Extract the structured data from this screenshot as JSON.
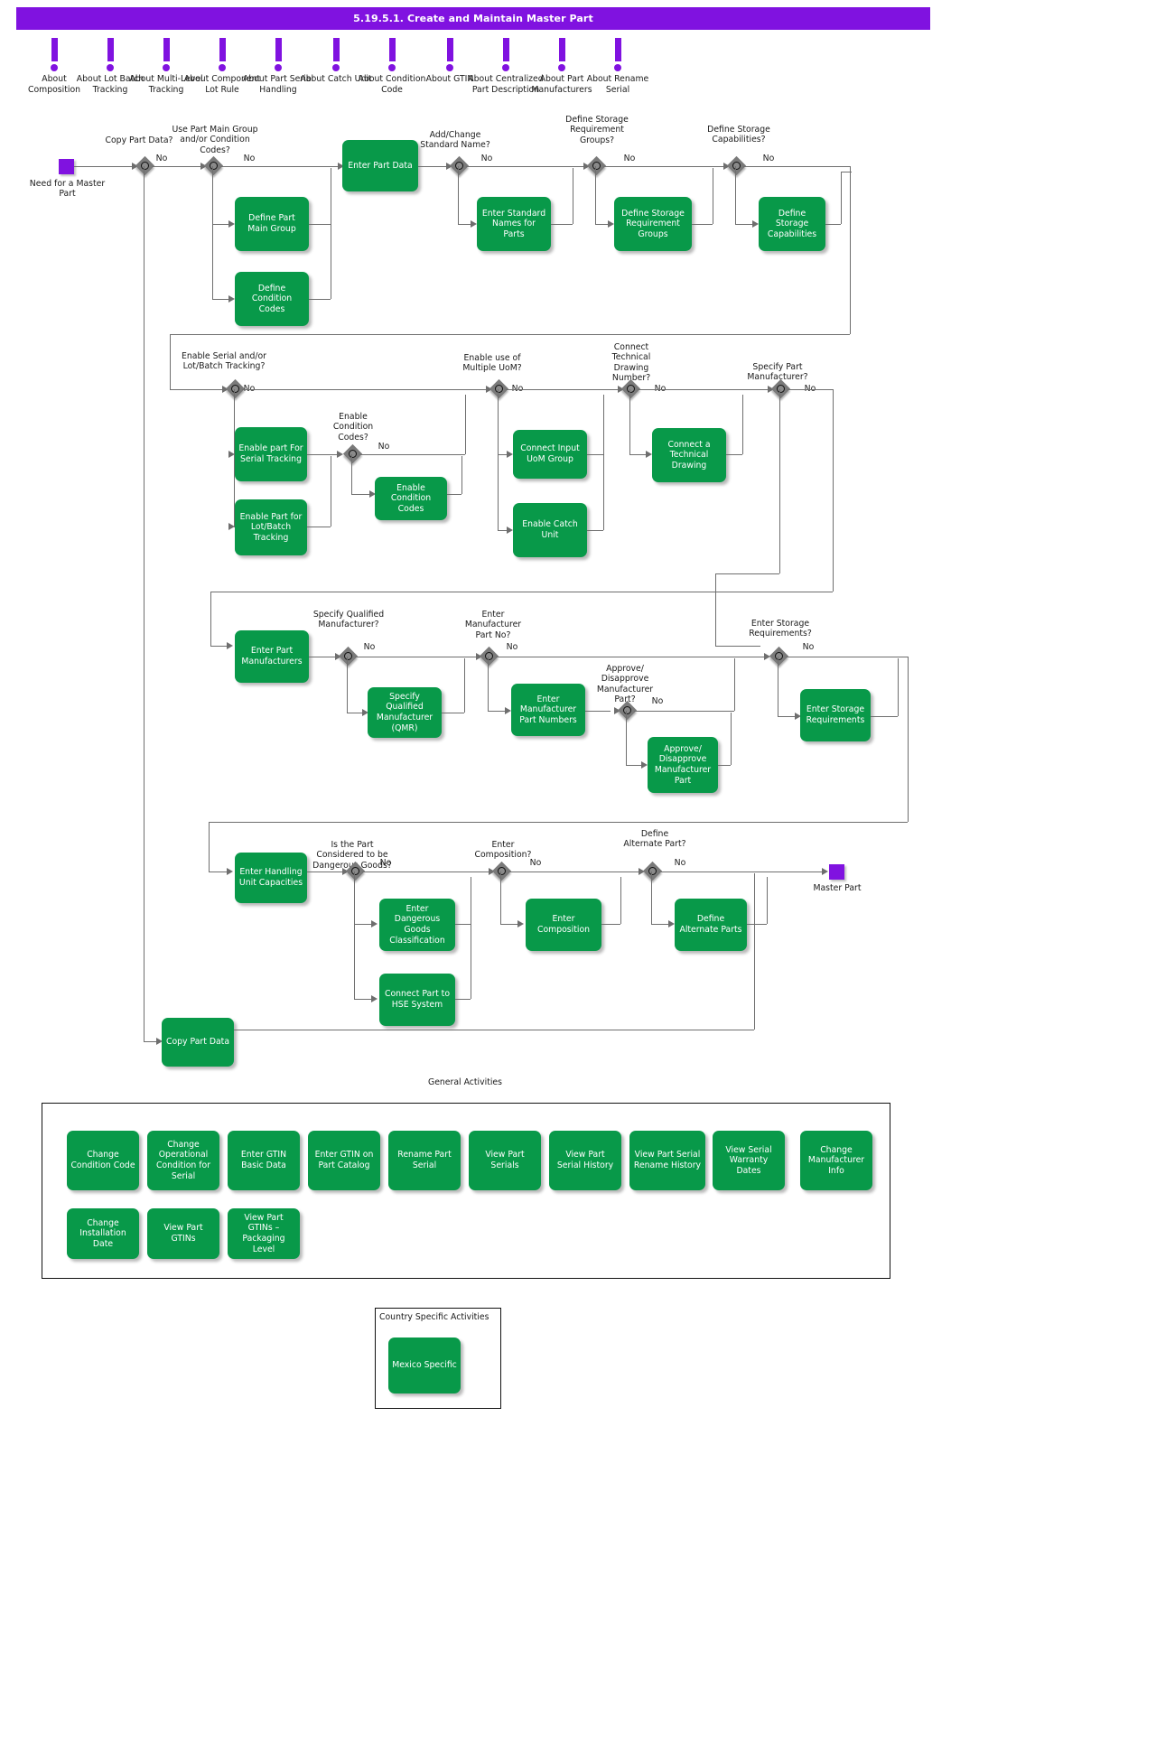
{
  "title": "5.19.5.1. Create and Maintain Master Part",
  "about_links": [
    {
      "label": "About Composition"
    },
    {
      "label": "About Lot Batch Tracking"
    },
    {
      "label": "About Multi-Level Tracking"
    },
    {
      "label": "About Component Lot Rule"
    },
    {
      "label": "About Part Serial Handling"
    },
    {
      "label": "About Catch Unit"
    },
    {
      "label": "About Condition Code"
    },
    {
      "label": "About GTIN"
    },
    {
      "label": "About Centralized Part Description"
    },
    {
      "label": "About Part Manufacturers"
    },
    {
      "label": "About Rename Serial"
    }
  ],
  "events": {
    "start": "Need for a Master Part",
    "end": "Master Part"
  },
  "gateways": [
    {
      "id": "g_copy",
      "question": "Copy Part Data?",
      "no": "No"
    },
    {
      "id": "g_maingroup",
      "question": "Use Part Main Group and/or Condition Codes?",
      "no": "No"
    },
    {
      "id": "g_stdname",
      "question": "Add/Change Standard Name?",
      "no": "No"
    },
    {
      "id": "g_storagereq",
      "question": "Define Storage Requirement Groups?",
      "no": "No"
    },
    {
      "id": "g_storagecap",
      "question": "Define Storage Capabilities?",
      "no": "No"
    },
    {
      "id": "g_serial",
      "question": "Enable Serial and/or Lot/Batch Tracking?",
      "no": "No"
    },
    {
      "id": "g_condcodes",
      "question": "Enable Condition Codes?",
      "no": "No"
    },
    {
      "id": "g_uom",
      "question": "Enable use of Multiple UoM?",
      "no": "No"
    },
    {
      "id": "g_drawing",
      "question": "Connect Technical Drawing Number?",
      "no": "No"
    },
    {
      "id": "g_specmanu",
      "question": "Specify Part Manufacturer?",
      "no": "No"
    },
    {
      "id": "g_qualmanu",
      "question": "Specify Qualified Manufacturer?",
      "no": "No"
    },
    {
      "id": "g_manupartno",
      "question": "Enter Manufacturer Part No?",
      "no": "No"
    },
    {
      "id": "g_approve",
      "question": "Approve/ Disapprove Manufacturer Part?",
      "no": "No"
    },
    {
      "id": "g_storagereqs",
      "question": "Enter Storage Requirements?",
      "no": "No"
    },
    {
      "id": "g_dangerous",
      "question": "Is the Part Considered to be Dangerous Goods?",
      "no": "No"
    },
    {
      "id": "g_composition",
      "question": "Enter Composition?",
      "no": "No"
    },
    {
      "id": "g_alternate",
      "question": "Define Alternate Part?",
      "no": "No"
    }
  ],
  "activities": [
    {
      "id": "a_partmaingroup",
      "label": "Define Part Main Group"
    },
    {
      "id": "a_conditioncodes",
      "label": "Define Condition Codes"
    },
    {
      "id": "a_enterpartdata",
      "label": "Enter Part Data"
    },
    {
      "id": "a_stdnames",
      "label": "Enter Standard Names for Parts"
    },
    {
      "id": "a_storagereqgroups",
      "label": "Define Storage Requirement Groups"
    },
    {
      "id": "a_storagecaps",
      "label": "Define Storage Capabilities"
    },
    {
      "id": "a_enableserial",
      "label": "Enable part For Serial Tracking"
    },
    {
      "id": "a_enablelotbatch",
      "label": "Enable Part for Lot/Batch Tracking"
    },
    {
      "id": "a_enablecondcodes",
      "label": "Enable Condition Codes"
    },
    {
      "id": "a_connectuom",
      "label": "Connect Input UoM Group"
    },
    {
      "id": "a_enablecatch",
      "label": "Enable Catch Unit"
    },
    {
      "id": "a_connectdrawing",
      "label": "Connect a Technical Drawing"
    },
    {
      "id": "a_partmanu",
      "label": "Enter Part Manufacturers"
    },
    {
      "id": "a_qmr",
      "label": "Specify Qualified Manufacturer (QMR)"
    },
    {
      "id": "a_manupartnos",
      "label": "Enter Manufacturer Part Numbers"
    },
    {
      "id": "a_approvemanu",
      "label": "Approve/ Disapprove Manufacturer Part"
    },
    {
      "id": "a_storagereqs",
      "label": "Enter Storage Requirements"
    },
    {
      "id": "a_handlingunit",
      "label": "Enter Handling Unit Capacities"
    },
    {
      "id": "a_dangerousgoods",
      "label": "Enter Dangerous Goods Classification"
    },
    {
      "id": "a_hse",
      "label": "Connect Part to HSE System"
    },
    {
      "id": "a_composition",
      "label": "Enter Composition"
    },
    {
      "id": "a_alternateparts",
      "label": "Define Alternate Parts"
    },
    {
      "id": "a_copypartdata",
      "label": "Copy Part Data"
    }
  ],
  "general_activities": {
    "title": "General Activities",
    "items": [
      {
        "label": "Change Condition Code"
      },
      {
        "label": "Change Operational Condition for Serial"
      },
      {
        "label": "Enter GTIN Basic Data"
      },
      {
        "label": "Enter GTIN on Part Catalog"
      },
      {
        "label": "Rename Part Serial"
      },
      {
        "label": "View Part Serials"
      },
      {
        "label": "View Part Serial History"
      },
      {
        "label": "View Part Serial Rename History"
      },
      {
        "label": "View Serial Warranty Dates"
      },
      {
        "label": "Change Manufacturer Info"
      },
      {
        "label": "Change Installation Date"
      },
      {
        "label": "View Part GTINs"
      },
      {
        "label": "View Part GTINs – Packaging Level"
      }
    ]
  },
  "country_specific": {
    "title": "Country Specific Activities",
    "items": [
      {
        "label": "Mexico Specific"
      }
    ]
  },
  "colors": {
    "title_bar": "#8012e0",
    "activity": "#089949",
    "event": "#8012e0",
    "gateway": "#7a7a7a",
    "connector": "#6e6e6e"
  }
}
